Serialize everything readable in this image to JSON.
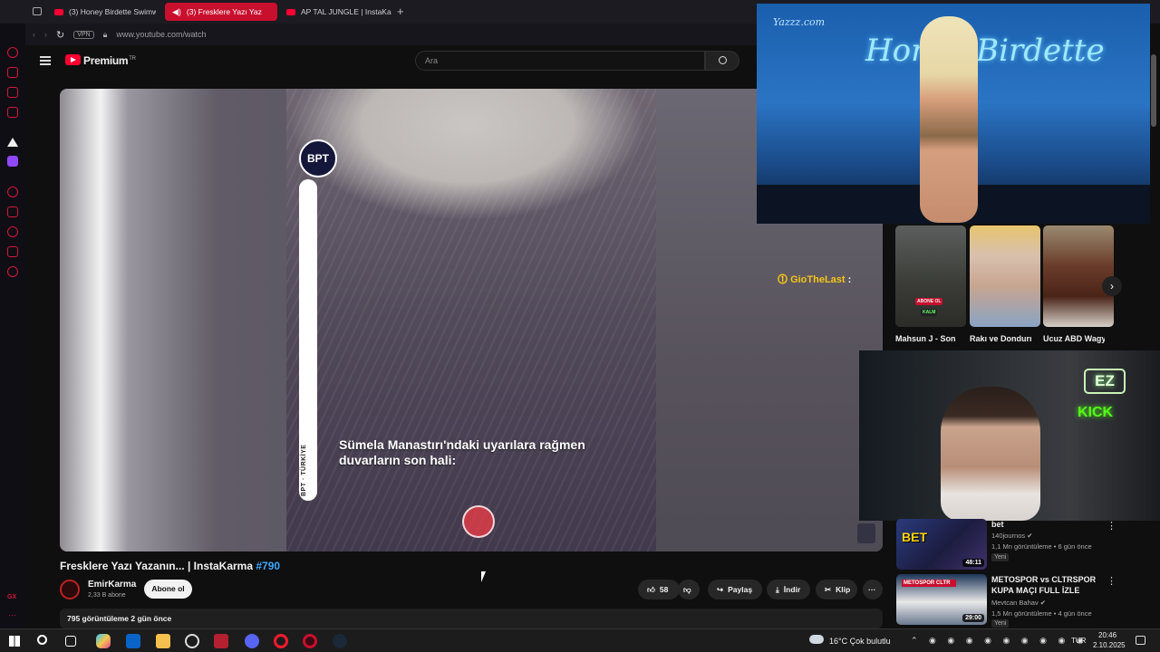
{
  "browser": {
    "tabs": [
      {
        "title": "(3) Honey Birdette Swimw",
        "active": false
      },
      {
        "title": "(3) Fresklere Yazı Yaz",
        "active": true
      },
      {
        "title": "AP TAL JUNGLE | InstaKa",
        "active": false
      }
    ],
    "vpn_label": "VPN",
    "url": "www.youtube.com/watch"
  },
  "youtube": {
    "brand": "Premium",
    "brand_region": "TR",
    "search_placeholder": "Ara"
  },
  "video": {
    "logo_text": "BPT",
    "side_label_1": "TÜRKİYE",
    "side_label_2": "BPT",
    "caption": "Sümela Manastırı'ndaki uyarılara rağmen duvarların son hali:",
    "title": "Fresklere Yazı Yazanın... | InstaKarma",
    "hashtag": "#790",
    "channel_name": "EmirKarma",
    "subscribers": "2,33 B abone",
    "subscribe_label": "Abone ol",
    "likes": "58",
    "share_label": "Paylaş",
    "download_label": "İndir",
    "clip_label": "Klip",
    "views_line": "795 görüntüleme  2 gün önce"
  },
  "overlay_top": {
    "watermark": "Yazzz.com",
    "brand_logo": "Honey Birdette"
  },
  "chat": {
    "user": "GioTheLast",
    "separator": ":"
  },
  "webcam": {
    "sign_ez": "EZ",
    "sign_kick": "KICK"
  },
  "strip": {
    "items": [
      {
        "title": "Mahsun J - Son Kina"
      },
      {
        "title": "Rakı ve Dondurma?"
      },
      {
        "title": "Ucuz ABD Wagyu Et"
      }
    ],
    "badge_text": "ABONE OL",
    "badge_text2": "KALM"
  },
  "sidebar_videos": [
    {
      "title": "bet",
      "channel": "140journos",
      "meta": "1,1 Mn görüntüleme • 6 gün önce",
      "badge": "Yeni",
      "duration": "48:11",
      "thumb_text": "BET"
    },
    {
      "title": "METOSPOR vs CLTRSPOR KUPA MAÇI FULL İZLE",
      "channel": "Mevtcan Bahav",
      "meta": "1,5 Mn görüntüleme • 4 gün önce",
      "badge": "Yeni",
      "duration": "29:00",
      "thumb_text": "METOSPOR CLTR"
    }
  ],
  "taskbar": {
    "weather": "16°C  Çok bulutlu",
    "lang": "TUR",
    "time": "20:46",
    "date": "2.10.2025"
  },
  "colors": {
    "accent_red": "#c8102e",
    "youtube_red": "#ff0033",
    "link_blue": "#3ea6ff",
    "kick_green": "#53fc18"
  }
}
